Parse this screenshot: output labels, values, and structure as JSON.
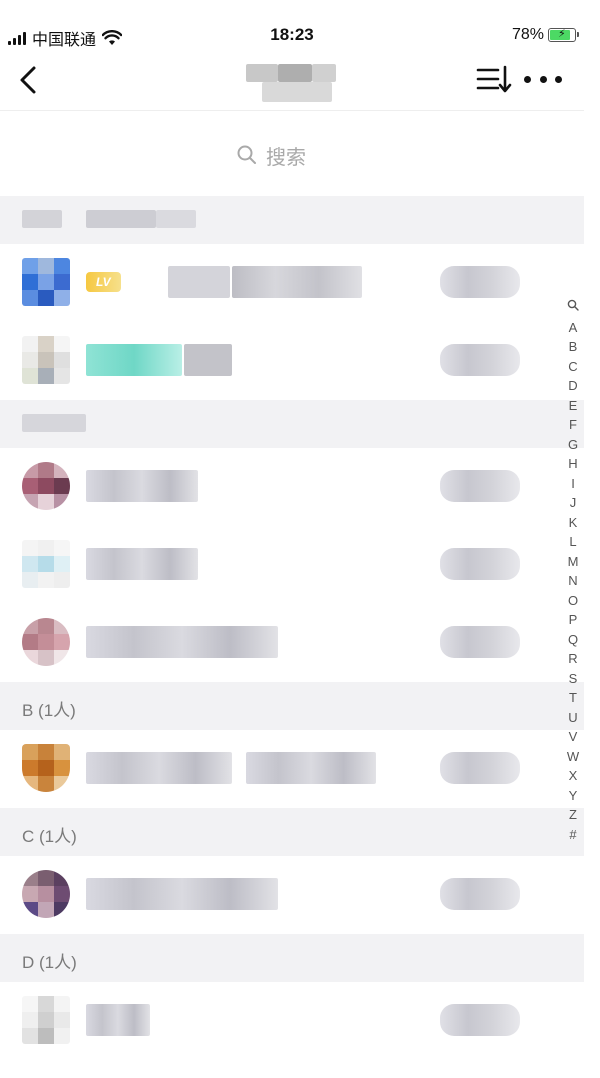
{
  "status_bar": {
    "carrier": "中国联通",
    "time": "18:23",
    "battery": "78%",
    "battery_level": 0.78
  },
  "search": {
    "placeholder": "搜索"
  },
  "groups": [
    {
      "id": "admins",
      "label": "",
      "rows": [
        {
          "avatar": "colorful",
          "badge": "LV",
          "role_visible": true
        },
        {
          "avatar": "mixed",
          "badge": "teal",
          "role_visible": true
        }
      ]
    },
    {
      "id": "members",
      "label": "",
      "rows": [
        {
          "avatar": "round"
        },
        {
          "avatar": "light"
        },
        {
          "avatar": "round"
        }
      ]
    },
    {
      "id": "B",
      "label": "B (1人)",
      "rows": [
        {
          "avatar": "orange"
        }
      ]
    },
    {
      "id": "C",
      "label": "C (1人)",
      "rows": [
        {
          "avatar": "round-dark"
        }
      ]
    },
    {
      "id": "D",
      "label": "D (1人)",
      "rows": [
        {
          "avatar": "sketch"
        }
      ]
    }
  ],
  "index_letters": [
    "A",
    "B",
    "C",
    "D",
    "E",
    "F",
    "G",
    "H",
    "I",
    "J",
    "K",
    "L",
    "M",
    "N",
    "O",
    "P",
    "Q",
    "R",
    "S",
    "T",
    "U",
    "V",
    "W",
    "X",
    "Y",
    "Z",
    "#"
  ],
  "icons": {
    "back": "chevron-left-icon",
    "sort": "sort-list-icon",
    "more": "more-dots-icon",
    "search": "search-icon",
    "wifi": "wifi-icon",
    "signal": "signal-icon",
    "battery": "battery-icon"
  }
}
